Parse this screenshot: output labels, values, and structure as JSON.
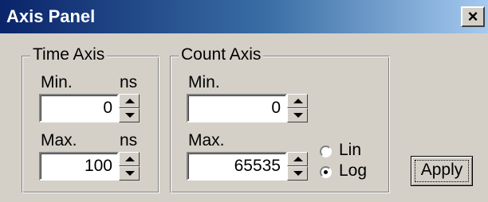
{
  "window": {
    "title": "Axis Panel",
    "close_label": "×"
  },
  "time_axis": {
    "title": "Time Axis",
    "min_label": "Min.",
    "min_unit": "ns",
    "min_value": "0",
    "max_label": "Max.",
    "max_unit": "ns",
    "max_value": "100"
  },
  "count_axis": {
    "title": "Count Axis",
    "min_label": "Min.",
    "min_value": "0",
    "max_label": "Max.",
    "max_value": "65535",
    "scale_options": [
      "Lin",
      "Log"
    ],
    "scale_selected": "Log"
  },
  "apply_label": "Apply",
  "icons": {
    "close": "close-icon",
    "spin_up": "arrow-up-icon",
    "spin_down": "arrow-down-icon"
  }
}
